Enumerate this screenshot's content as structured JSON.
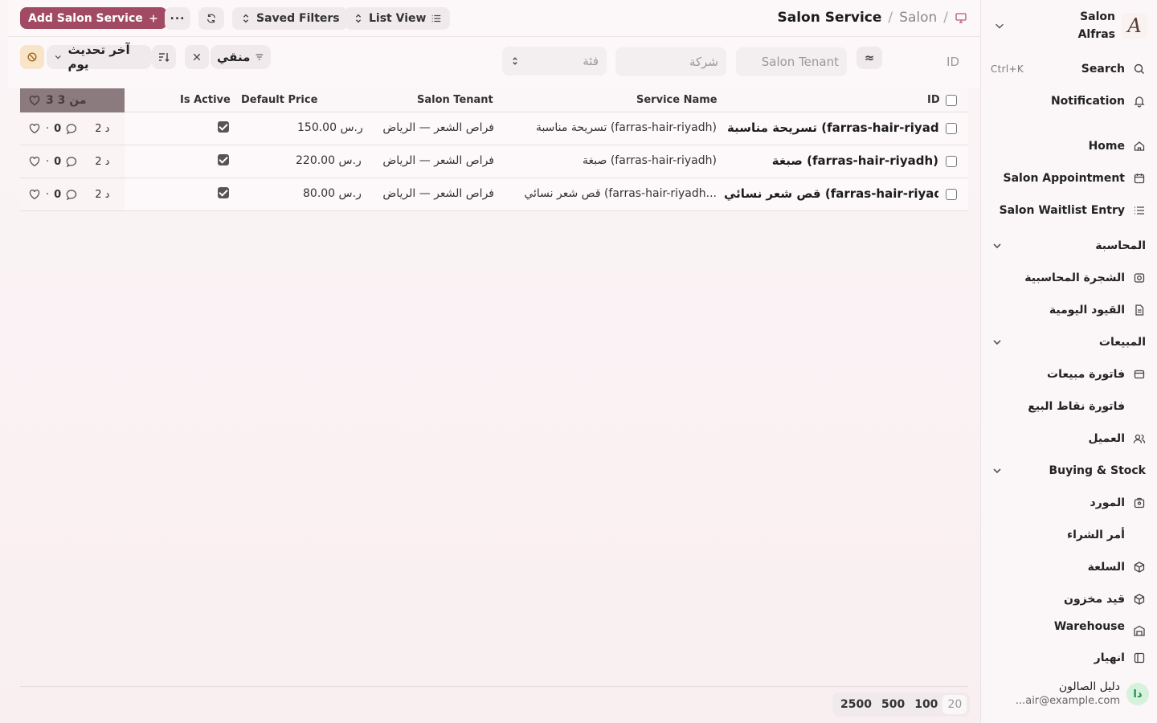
{
  "app": {
    "brand": "Salon Alfras",
    "brand_line1": "Salon",
    "brand_line2": "Alfras",
    "brand_logo_letter": "A"
  },
  "sidebar": {
    "search_label": "Search",
    "search_shortcut": "Ctrl+K",
    "notification_label": "Notification",
    "items": [
      {
        "label": "Home",
        "icon": "home-icon"
      },
      {
        "label": "Salon Appointment",
        "icon": "calendar-icon"
      },
      {
        "label": "Salon Waitlist Entry",
        "icon": "list-icon"
      }
    ],
    "sections": [
      {
        "label": "المحاسبة",
        "items": [
          {
            "label": "الشجرة المحاسبية",
            "icon": "ledger-icon"
          },
          {
            "label": "القيود اليومية",
            "icon": "file-icon"
          }
        ]
      },
      {
        "label": "المبيعات",
        "items": [
          {
            "label": "فاتورة مبيعات",
            "icon": "invoice-icon"
          },
          {
            "label": "فاتورة نقاط البيع",
            "icon": ""
          },
          {
            "label": "العميل",
            "icon": "users-icon"
          }
        ]
      },
      {
        "label": "Buying & Stock",
        "items": [
          {
            "label": "المورد",
            "icon": "supplier-icon"
          },
          {
            "label": "أمر الشراء",
            "icon": ""
          },
          {
            "label": "السلعة",
            "icon": "box-icon"
          },
          {
            "label": "قيد مخزون",
            "icon": "box-icon"
          },
          {
            "label": "Warehouse",
            "icon": "warehouse-icon"
          }
        ]
      }
    ],
    "collapse_label": "انهيار",
    "user": {
      "initials": "دا",
      "name": "دليل الصالون",
      "email": "...air@example.com"
    }
  },
  "topbar": {
    "breadcrumb": [
      "Salon",
      "Salon Service"
    ],
    "add_button": "Add Salon Service",
    "more_label": "...",
    "saved_filters": "Saved Filters",
    "list_view": "List View"
  },
  "filters": {
    "id_placeholder": "ID",
    "tenant_placeholder": "Salon Tenant",
    "company_placeholder": "شركة",
    "category_placeholder": "فئة",
    "filter_chip": "منقي",
    "sort_label": "آخر تحديث يوم"
  },
  "table": {
    "columns": [
      "ID",
      "Service Name",
      "Salon Tenant",
      "Default Price",
      "Is Active"
    ],
    "count_label": "3 من 3",
    "rows": [
      {
        "id": "تسريحة مناسبة (farras-hair-riyadh)",
        "service_name": "تسريحة مناسبة (farras-hair-riyadh)",
        "tenant": "فراص الشعر — الرياض",
        "price": "ر.س 150.00",
        "active": true,
        "comments": "0",
        "modified": "2 د"
      },
      {
        "id": "صبغة (farras-hair-riyadh)",
        "service_name": "صبغة (farras-hair-riyadh)",
        "tenant": "فراص الشعر — الرياض",
        "price": "ر.س 220.00",
        "active": true,
        "comments": "0",
        "modified": "2 د"
      },
      {
        "id": "قص شعر نسائي (farras-hair-riyadh)",
        "service_name": "قص شعر نسائي (farras-hair-riyadh...",
        "tenant": "فراص الشعر — الرياض",
        "price": "ر.س 80.00",
        "active": true,
        "comments": "0",
        "modified": "2 د"
      }
    ]
  },
  "paging": {
    "options": [
      "20",
      "100",
      "500",
      "2500"
    ],
    "active": "20"
  },
  "colors": {
    "accent": "#a24a64",
    "background": "#fbf5f6",
    "count_header": "#8b7a7e"
  }
}
